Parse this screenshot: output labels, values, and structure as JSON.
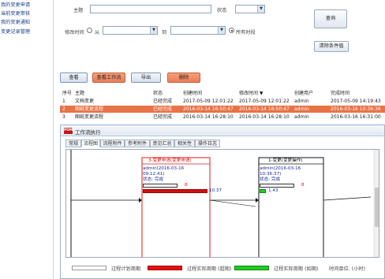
{
  "sidebar": {
    "items": [
      {
        "label": "我的变更申请"
      },
      {
        "label": "当前变更审核"
      },
      {
        "label": "我的变更通知"
      },
      {
        "label": "变更记录管理"
      }
    ]
  },
  "search": {
    "subject_label": "主题",
    "status_label": "状态",
    "modified_time_label": "修改时间",
    "from_label": "从",
    "to_label": "到",
    "all_time_label": "所有时段",
    "query_button": "查询",
    "clear_button": "清除条件值"
  },
  "toolbar": {
    "view": "查看",
    "view_flow": "查看工作流",
    "export": "导出",
    "delete": "删除"
  },
  "table": {
    "headers": [
      "序号",
      "主题",
      "状态",
      "创建时间",
      "修改时间 ▼",
      "创建用户",
      "完成时间"
    ],
    "rows": [
      [
        "1",
        "文档变更",
        "已经完成",
        "2017-05-09 12:01:22",
        "2017-05-09 12:01:22",
        "admin",
        "2017-05-09 14:19:43"
      ],
      [
        "2",
        "图纸变更流程",
        "已经完成",
        "2016-03-14 16:50:47",
        "2016-03-14 16:50:47",
        "admin",
        "2016-03-16 10:36:36"
      ],
      [
        "3",
        "图纸变更流程",
        "已经完成",
        "2016-03-14 16:28:10",
        "2016-03-14 16:28:10",
        "admin",
        "2016-03-16 16:31:00"
      ]
    ]
  },
  "panel": {
    "logo": "PDM",
    "title": "工作流执行",
    "tabs": [
      "常规",
      "流程图",
      "流程附件",
      "参考附件",
      "意见汇总",
      "相关性",
      "操作日志"
    ],
    "active_tab": 1
  },
  "diagram": {
    "node1": {
      "title": "3-变更申请(变更申请)",
      "lines": [
        "admin(2016-03-16",
        "09:12:41)",
        "状态: 完成"
      ],
      "planned": "8",
      "actual": "10.37"
    },
    "node2": {
      "title": "1-变更(变更操作)",
      "lines": [
        "admin(2016-03-16",
        "10:36:37)",
        "状态: 完成"
      ],
      "planned": "8",
      "actual": "1.43"
    }
  },
  "legend": {
    "planned": "过程计划周期",
    "actual_over": "过程实际周期 (超期)",
    "actual_ok": "过程实际周期 (如期)",
    "unit": "时间单位: (小时)",
    "colors": {
      "planned": "#ffffff",
      "over": "#e01010",
      "ok": "#22cc22"
    }
  },
  "colors": {
    "accent": "#f08a5d",
    "selected_row": "#e77346"
  }
}
